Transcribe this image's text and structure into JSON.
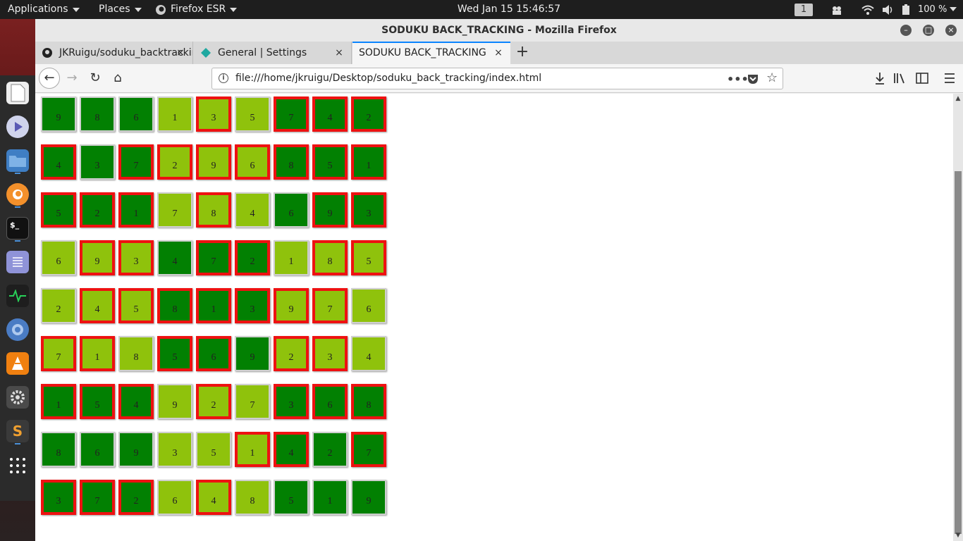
{
  "topbar": {
    "applications": "Applications",
    "places": "Places",
    "firefox_esr": "Firefox ESR",
    "clock": "Wed Jan 15  15:46:57",
    "workspace": "1",
    "battery": "100 %"
  },
  "window": {
    "title": "SODUKU BACK_TRACKING - Mozilla Firefox",
    "tabs": [
      {
        "label": "JKRuigu/soduku_backtracking"
      },
      {
        "label": "General | Settings"
      },
      {
        "label": "SODUKU BACK_TRACKING"
      }
    ],
    "url": "file:///home/jkruigu/Desktop/soduku_back_tracking/index.html"
  },
  "colors": {
    "dark_cell": "#028002",
    "light_cell": "#8fc20c",
    "highlight_border": "#ee1111"
  },
  "grid": {
    "values": [
      [
        9,
        8,
        6,
        1,
        3,
        5,
        7,
        4,
        2
      ],
      [
        4,
        3,
        7,
        2,
        9,
        6,
        8,
        5,
        1
      ],
      [
        5,
        2,
        1,
        7,
        8,
        4,
        6,
        9,
        3
      ],
      [
        6,
        9,
        3,
        4,
        7,
        2,
        1,
        8,
        5
      ],
      [
        2,
        4,
        5,
        8,
        1,
        3,
        9,
        7,
        6
      ],
      [
        7,
        1,
        8,
        5,
        6,
        9,
        2,
        3,
        4
      ],
      [
        1,
        5,
        4,
        9,
        2,
        7,
        3,
        6,
        8
      ],
      [
        8,
        6,
        9,
        3,
        5,
        1,
        4,
        2,
        7
      ],
      [
        3,
        7,
        2,
        6,
        4,
        8,
        5,
        1,
        9
      ]
    ],
    "shade": [
      "DDDLLLDDD",
      "DDDLLLDDD",
      "DDDLLLDDD",
      "LLLDDDLLL",
      "LLLDDDLLL",
      "LLLDDDLLL",
      "DDDLLLDDD",
      "DDDLLLDDD",
      "DDDLLLDDD"
    ],
    "highlighted": [
      "000010111",
      "101111111",
      "111010011",
      "011011011",
      "011111110",
      "110110110",
      "111010111",
      "000001101",
      "111010000"
    ]
  }
}
